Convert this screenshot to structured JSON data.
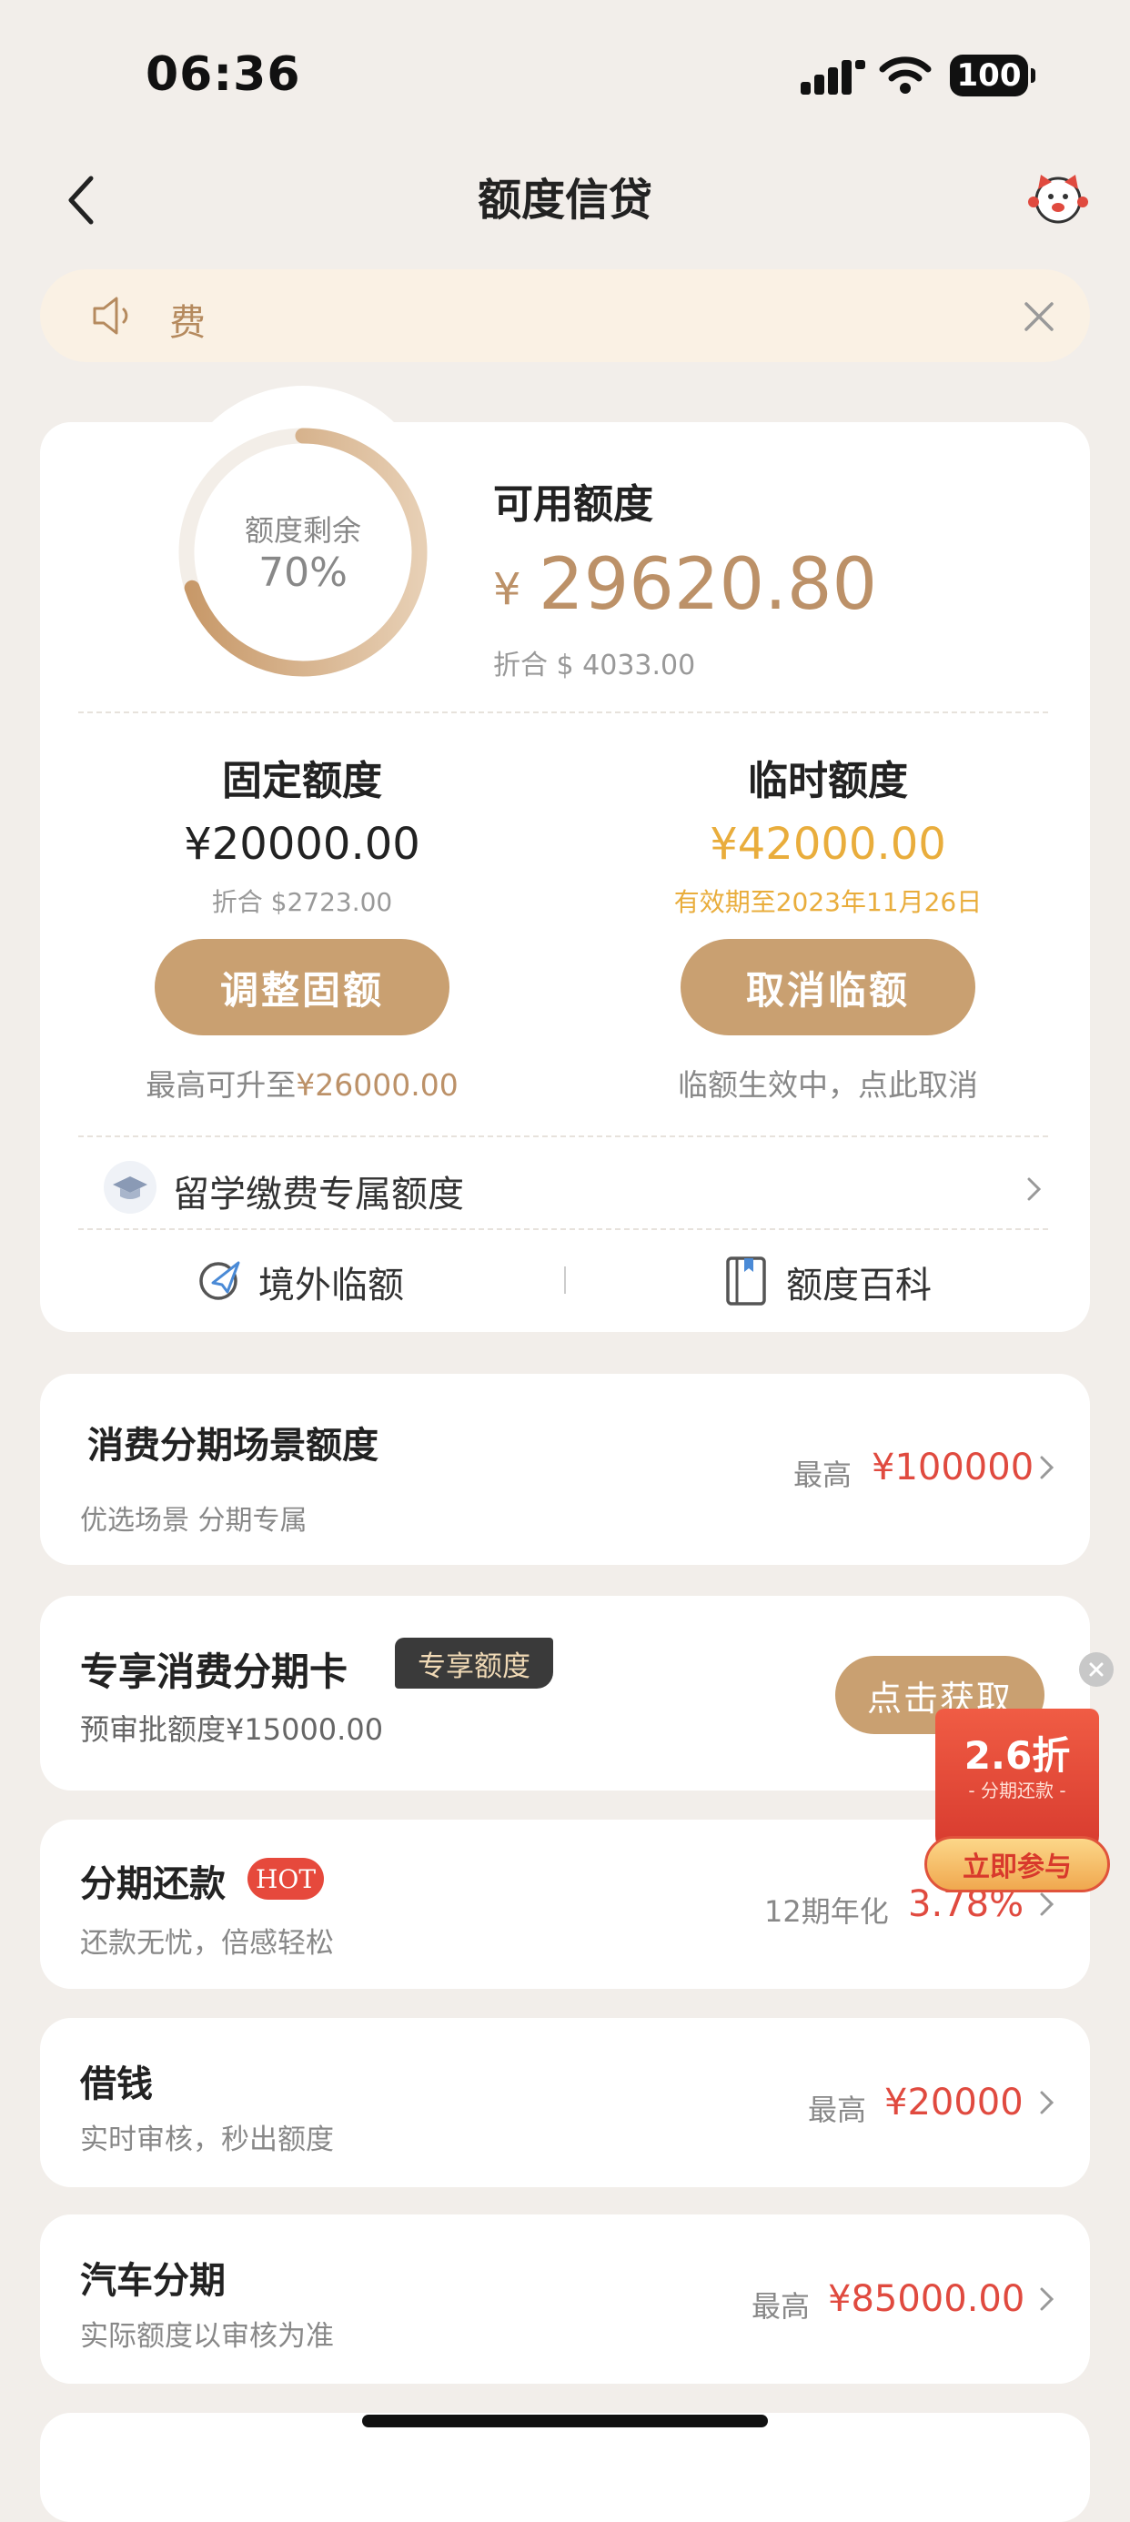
{
  "status": {
    "time": "06:36",
    "battery": "100"
  },
  "nav": {
    "title": "额度信贷"
  },
  "notice": {
    "text": "费"
  },
  "credit": {
    "ring_label": "额度剩余",
    "ring_percent": "70%",
    "ring_fraction": 0.7,
    "available_title": "可用额度",
    "currency": "¥",
    "available_amount": "29620.80",
    "available_usd": "折合 $ 4033.00"
  },
  "fixed": {
    "title": "固定额度",
    "amount": "¥20000.00",
    "usd": "折合 $2723.00",
    "button": "调整固额",
    "note_prefix": "最高可升至",
    "note_value": "¥26000.00"
  },
  "temp": {
    "title": "临时额度",
    "amount": "¥42000.00",
    "validity": "有效期至2023年11月26日",
    "button": "取消临额",
    "note": "临额生效中，点此取消"
  },
  "study_abroad": {
    "label": "留学缴费专属额度"
  },
  "links": {
    "overseas": "境外临额",
    "encyclopedia": "额度百科"
  },
  "installment_scene": {
    "title": "消费分期场景额度",
    "sub": "优选场景 分期专属",
    "label": "最高",
    "value": "¥100000"
  },
  "card_offer": {
    "title": "专享消费分期卡",
    "badge": "专享额度",
    "sub": "预审批额度¥15000.00",
    "button": "点击获取"
  },
  "installment_repay": {
    "title": "分期还款",
    "badge": "HOT",
    "sub": "还款无忧，倍感轻松",
    "label": "12期年化",
    "value": "3.78%"
  },
  "borrow": {
    "title": "借钱",
    "sub": "实时审核，秒出额度",
    "label": "最高",
    "value": "¥20000"
  },
  "car": {
    "title": "汽车分期",
    "sub": "实际额度以审核为准",
    "label": "最高",
    "value": "¥85000.00"
  },
  "promo": {
    "discount": "2.6折",
    "sub": "- 分期还款 -",
    "button": "立即参与"
  },
  "colors": {
    "gold": "#c9a071",
    "red": "#e04a3f",
    "background": "#f2eeea"
  }
}
